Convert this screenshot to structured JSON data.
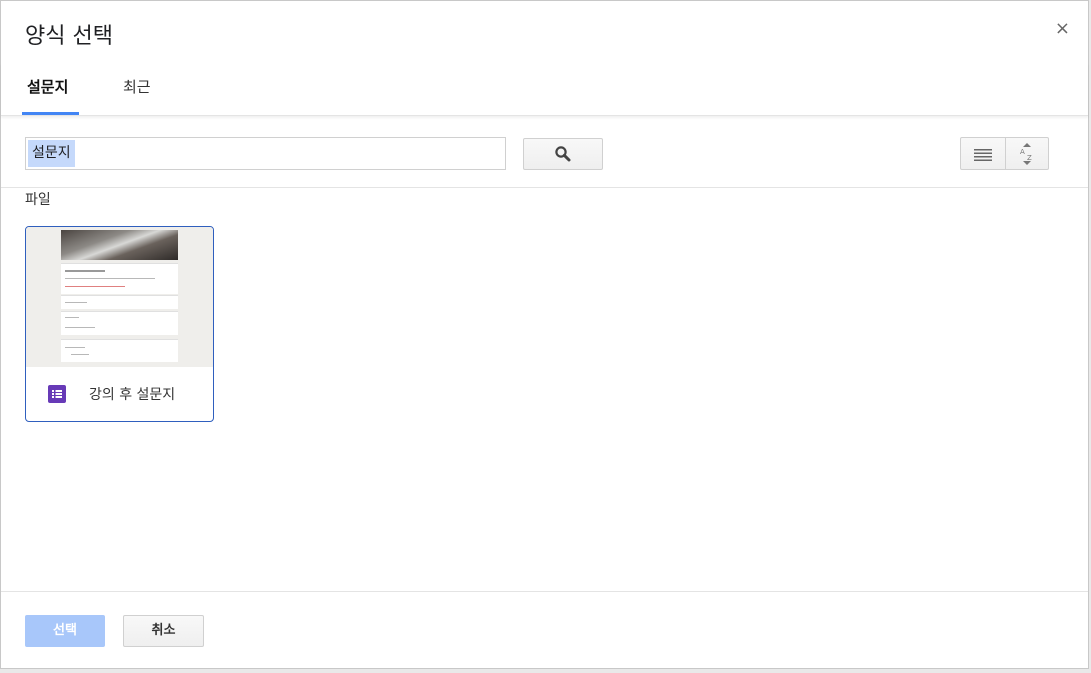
{
  "dialog": {
    "title": "양식 선택",
    "close_glyph": "×"
  },
  "tabs": [
    {
      "label": "설문지",
      "active": true
    },
    {
      "label": "최근",
      "active": false
    }
  ],
  "search": {
    "value": "설문지",
    "button_icon": "search-icon"
  },
  "view_controls": {
    "list_icon": "list-view-icon",
    "sort_icon": "sort-az-icon"
  },
  "files_section": {
    "label": "파일",
    "items": [
      {
        "name": "강의 후 설문지",
        "type_icon": "google-forms-icon",
        "selected": true
      }
    ]
  },
  "footer": {
    "select_label": "선택",
    "cancel_label": "취소"
  },
  "colors": {
    "accent": "#4285f4",
    "forms_purple": "#673ab7",
    "select_disabled": "#a8c7fa",
    "selected_border": "#2f5fbe"
  }
}
